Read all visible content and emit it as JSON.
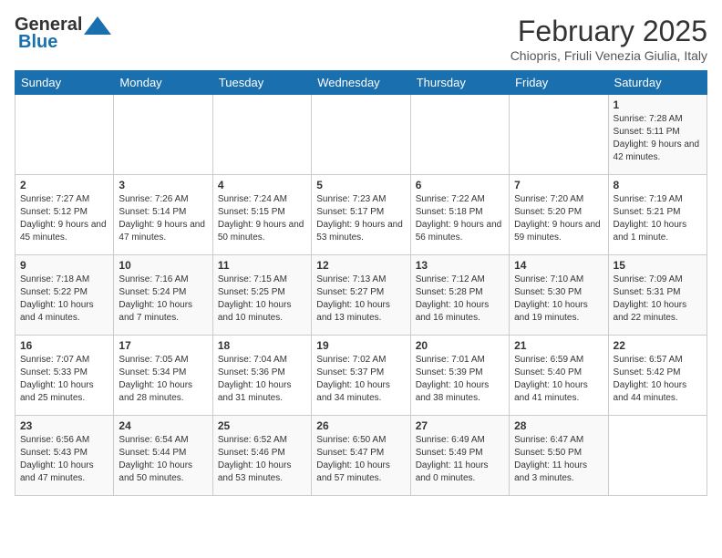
{
  "header": {
    "logo_line1": "General",
    "logo_line2": "Blue",
    "month": "February 2025",
    "location": "Chiopris, Friuli Venezia Giulia, Italy"
  },
  "days_of_week": [
    "Sunday",
    "Monday",
    "Tuesday",
    "Wednesday",
    "Thursday",
    "Friday",
    "Saturday"
  ],
  "weeks": [
    [
      {
        "day": "",
        "info": ""
      },
      {
        "day": "",
        "info": ""
      },
      {
        "day": "",
        "info": ""
      },
      {
        "day": "",
        "info": ""
      },
      {
        "day": "",
        "info": ""
      },
      {
        "day": "",
        "info": ""
      },
      {
        "day": "1",
        "info": "Sunrise: 7:28 AM\nSunset: 5:11 PM\nDaylight: 9 hours and 42 minutes."
      }
    ],
    [
      {
        "day": "2",
        "info": "Sunrise: 7:27 AM\nSunset: 5:12 PM\nDaylight: 9 hours and 45 minutes."
      },
      {
        "day": "3",
        "info": "Sunrise: 7:26 AM\nSunset: 5:14 PM\nDaylight: 9 hours and 47 minutes."
      },
      {
        "day": "4",
        "info": "Sunrise: 7:24 AM\nSunset: 5:15 PM\nDaylight: 9 hours and 50 minutes."
      },
      {
        "day": "5",
        "info": "Sunrise: 7:23 AM\nSunset: 5:17 PM\nDaylight: 9 hours and 53 minutes."
      },
      {
        "day": "6",
        "info": "Sunrise: 7:22 AM\nSunset: 5:18 PM\nDaylight: 9 hours and 56 minutes."
      },
      {
        "day": "7",
        "info": "Sunrise: 7:20 AM\nSunset: 5:20 PM\nDaylight: 9 hours and 59 minutes."
      },
      {
        "day": "8",
        "info": "Sunrise: 7:19 AM\nSunset: 5:21 PM\nDaylight: 10 hours and 1 minute."
      }
    ],
    [
      {
        "day": "9",
        "info": "Sunrise: 7:18 AM\nSunset: 5:22 PM\nDaylight: 10 hours and 4 minutes."
      },
      {
        "day": "10",
        "info": "Sunrise: 7:16 AM\nSunset: 5:24 PM\nDaylight: 10 hours and 7 minutes."
      },
      {
        "day": "11",
        "info": "Sunrise: 7:15 AM\nSunset: 5:25 PM\nDaylight: 10 hours and 10 minutes."
      },
      {
        "day": "12",
        "info": "Sunrise: 7:13 AM\nSunset: 5:27 PM\nDaylight: 10 hours and 13 minutes."
      },
      {
        "day": "13",
        "info": "Sunrise: 7:12 AM\nSunset: 5:28 PM\nDaylight: 10 hours and 16 minutes."
      },
      {
        "day": "14",
        "info": "Sunrise: 7:10 AM\nSunset: 5:30 PM\nDaylight: 10 hours and 19 minutes."
      },
      {
        "day": "15",
        "info": "Sunrise: 7:09 AM\nSunset: 5:31 PM\nDaylight: 10 hours and 22 minutes."
      }
    ],
    [
      {
        "day": "16",
        "info": "Sunrise: 7:07 AM\nSunset: 5:33 PM\nDaylight: 10 hours and 25 minutes."
      },
      {
        "day": "17",
        "info": "Sunrise: 7:05 AM\nSunset: 5:34 PM\nDaylight: 10 hours and 28 minutes."
      },
      {
        "day": "18",
        "info": "Sunrise: 7:04 AM\nSunset: 5:36 PM\nDaylight: 10 hours and 31 minutes."
      },
      {
        "day": "19",
        "info": "Sunrise: 7:02 AM\nSunset: 5:37 PM\nDaylight: 10 hours and 34 minutes."
      },
      {
        "day": "20",
        "info": "Sunrise: 7:01 AM\nSunset: 5:39 PM\nDaylight: 10 hours and 38 minutes."
      },
      {
        "day": "21",
        "info": "Sunrise: 6:59 AM\nSunset: 5:40 PM\nDaylight: 10 hours and 41 minutes."
      },
      {
        "day": "22",
        "info": "Sunrise: 6:57 AM\nSunset: 5:42 PM\nDaylight: 10 hours and 44 minutes."
      }
    ],
    [
      {
        "day": "23",
        "info": "Sunrise: 6:56 AM\nSunset: 5:43 PM\nDaylight: 10 hours and 47 minutes."
      },
      {
        "day": "24",
        "info": "Sunrise: 6:54 AM\nSunset: 5:44 PM\nDaylight: 10 hours and 50 minutes."
      },
      {
        "day": "25",
        "info": "Sunrise: 6:52 AM\nSunset: 5:46 PM\nDaylight: 10 hours and 53 minutes."
      },
      {
        "day": "26",
        "info": "Sunrise: 6:50 AM\nSunset: 5:47 PM\nDaylight: 10 hours and 57 minutes."
      },
      {
        "day": "27",
        "info": "Sunrise: 6:49 AM\nSunset: 5:49 PM\nDaylight: 11 hours and 0 minutes."
      },
      {
        "day": "28",
        "info": "Sunrise: 6:47 AM\nSunset: 5:50 PM\nDaylight: 11 hours and 3 minutes."
      },
      {
        "day": "",
        "info": ""
      }
    ]
  ]
}
